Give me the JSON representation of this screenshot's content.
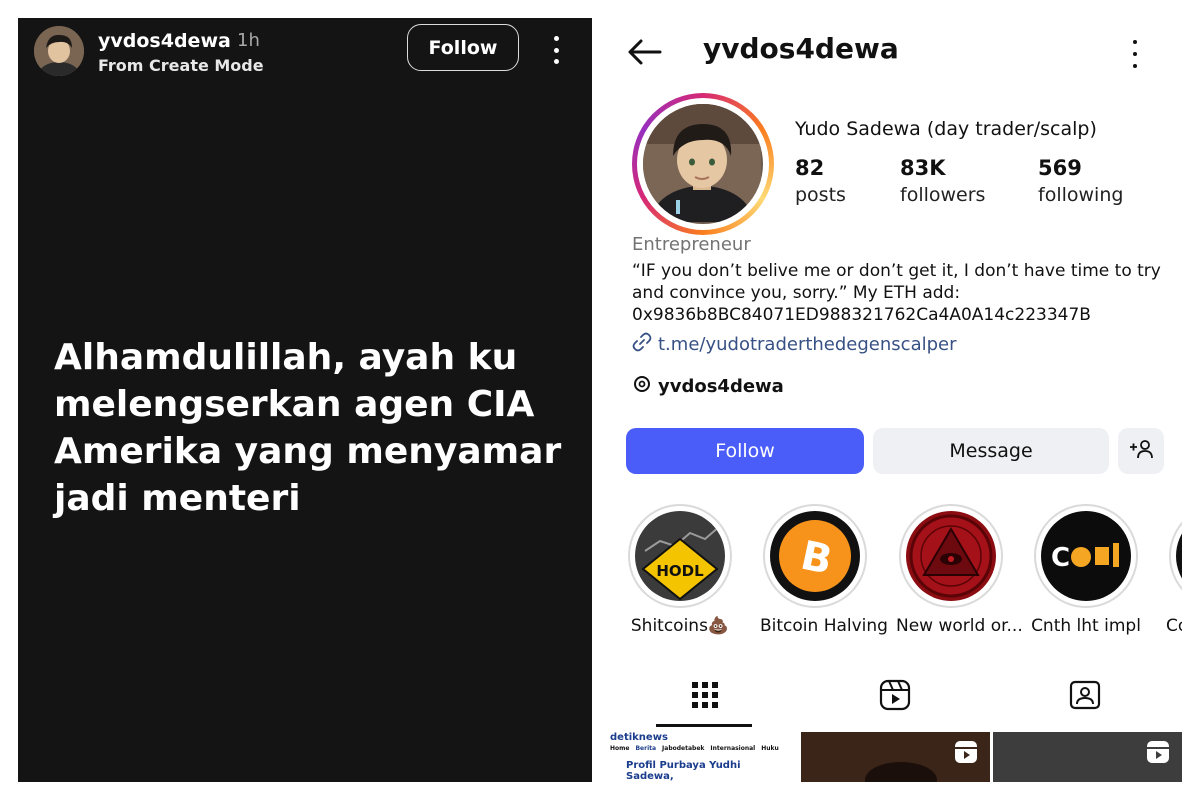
{
  "story": {
    "username": "yvdos4dewa",
    "time": "1h",
    "subtitle": "From Create Mode",
    "follow_label": "Follow",
    "caption": "Alhamdulillah, ayah ku melengserkan agen CIA Amerika yang menyamar jadi menteri",
    "bg_color": "#141414"
  },
  "profile": {
    "header_username": "yvdos4dewa",
    "full_name": "Yudo Sadewa (day trader/scalp)",
    "stats": [
      {
        "value": "82",
        "label": "posts"
      },
      {
        "value": "83K",
        "label": "followers"
      },
      {
        "value": "569",
        "label": "following"
      }
    ],
    "category": "Entrepreneur",
    "bio": "“IF you don’t belive me or don’t get it, I don’t have time to try and convince you, sorry.” My ETH add: 0x9836b8BC84071ED988321762Ca4A0A14c223347B",
    "link": "t.me/yudotraderthedegenscalper",
    "threads_handle": "yvdos4dewa",
    "follow_label": "Follow",
    "message_label": "Message",
    "follow_color": "#4a5df9",
    "highlights": [
      {
        "label": "Shitcoins💩",
        "icon": "hodl-icon"
      },
      {
        "label": "Bitcoin Halving",
        "icon": "bitcoin-icon"
      },
      {
        "label": "New world or...",
        "icon": "illuminati-eye-icon"
      },
      {
        "label": "Cnth lht impl",
        "icon": "coin-logo-icon"
      },
      {
        "label": "Co",
        "icon": "highlight-icon"
      }
    ],
    "tabs": [
      {
        "name": "grid",
        "icon": "grid-icon"
      },
      {
        "name": "reels",
        "icon": "reels-icon"
      },
      {
        "name": "tagged",
        "icon": "tagged-icon"
      }
    ],
    "thumb_news": {
      "brand": "detiknews",
      "nav": [
        "Home",
        "Berita",
        "Jabodetabek",
        "Internasional",
        "Huku"
      ],
      "headline": "Profil Purbaya Yudhi Sadewa,"
    }
  }
}
